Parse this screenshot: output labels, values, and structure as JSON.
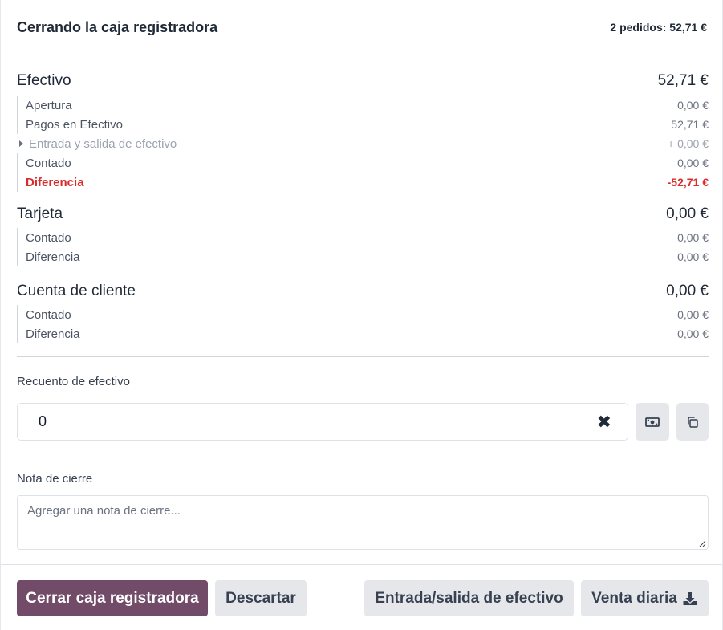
{
  "header": {
    "title": "Cerrando la caja registradora",
    "summary": "2 pedidos: 52,71 €"
  },
  "cash": {
    "label": "Efectivo",
    "amount": "52,71 €",
    "rows": [
      {
        "label": "Apertura",
        "amount": "0,00 €"
      },
      {
        "label": "Pagos en Efectivo",
        "amount": "52,71 €"
      },
      {
        "label": "Entrada y salida de efectivo",
        "amount": "+ 0,00 €"
      },
      {
        "label": "Contado",
        "amount": "0,00 €"
      },
      {
        "label": "Diferencia",
        "amount": "-52,71 €"
      }
    ]
  },
  "card": {
    "label": "Tarjeta",
    "amount": "0,00 €",
    "rows": [
      {
        "label": "Contado",
        "amount": "0,00 €"
      },
      {
        "label": "Diferencia",
        "amount": "0,00 €"
      }
    ]
  },
  "customer_account": {
    "label": "Cuenta de cliente",
    "amount": "0,00 €",
    "rows": [
      {
        "label": "Contado",
        "amount": "0,00 €"
      },
      {
        "label": "Diferencia",
        "amount": "0,00 €"
      }
    ]
  },
  "cash_count": {
    "label": "Recuento de efectivo",
    "value": "0",
    "clear_glyph": "✖"
  },
  "closing_note": {
    "label": "Nota de cierre",
    "placeholder": "Agregar una nota de cierre..."
  },
  "footer": {
    "close_label": "Cerrar caja registradora",
    "discard_label": "Descartar",
    "cash_in_out_label": "Entrada/salida de efectivo",
    "daily_sale_label": "Venta diaria"
  },
  "colors": {
    "primary": "#714b67",
    "danger": "#d92d2d",
    "button_bg": "#e5e7eb"
  },
  "icons": [
    "money-bill-icon",
    "copy-icon",
    "download-icon",
    "caret-right-icon",
    "close-icon"
  ]
}
